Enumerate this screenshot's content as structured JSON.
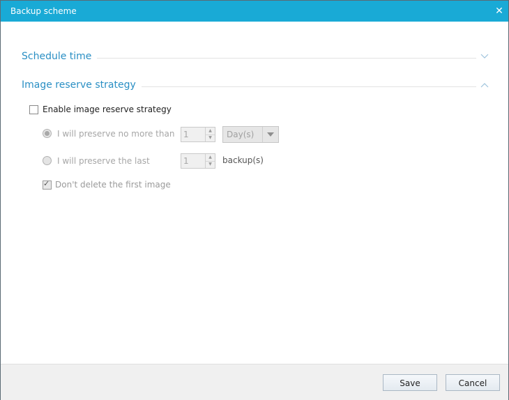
{
  "window": {
    "title": "Backup scheme",
    "close_icon": "close-icon"
  },
  "sections": {
    "schedule": {
      "title": "Schedule time",
      "icon": "chevron-down-icon"
    },
    "reserve": {
      "title": "Image reserve strategy",
      "icon": "chevron-up-icon"
    }
  },
  "enable_strategy": {
    "label": "Enable image reserve strategy",
    "checked": false
  },
  "option_no_more_than": {
    "label": "I will preserve no more than",
    "selected": true,
    "value": "1",
    "unit": "Day(s)"
  },
  "option_last": {
    "label": "I will preserve the last",
    "selected": false,
    "value": "1",
    "unit": "backup(s)"
  },
  "keep_first": {
    "label": "Don't delete the first image",
    "checked": true
  },
  "buttons": {
    "save": "Save",
    "cancel": "Cancel"
  },
  "colors": {
    "titlebar": "#19aad6",
    "section_title": "#2a8fc4"
  }
}
